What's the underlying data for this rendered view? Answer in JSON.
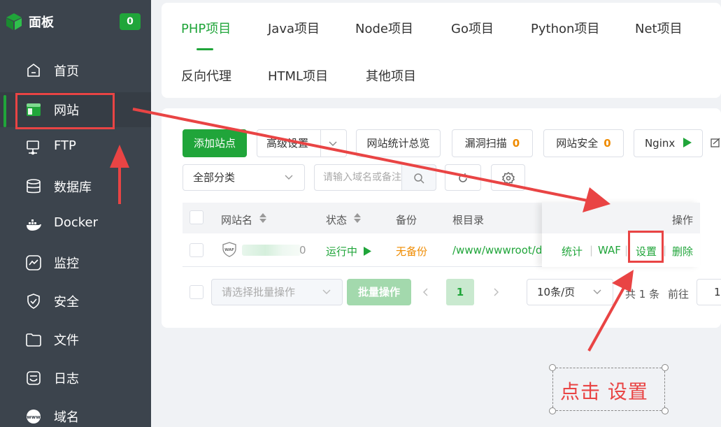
{
  "sidebar": {
    "brand": "面板",
    "badge": "0",
    "items": [
      {
        "label": "首页",
        "icon": "home-icon"
      },
      {
        "label": "网站",
        "icon": "website-icon"
      },
      {
        "label": "FTP",
        "icon": "ftp-icon"
      },
      {
        "label": "数据库",
        "icon": "database-icon"
      },
      {
        "label": "Docker",
        "icon": "docker-icon"
      },
      {
        "label": "监控",
        "icon": "monitor-icon"
      },
      {
        "label": "安全",
        "icon": "shield-icon"
      },
      {
        "label": "文件",
        "icon": "folder-icon"
      },
      {
        "label": "日志",
        "icon": "log-icon"
      },
      {
        "label": "域名",
        "icon": "globe-icon"
      }
    ]
  },
  "tabs": [
    "PHP项目",
    "Java项目",
    "Node项目",
    "Go项目",
    "Python项目",
    "Net项目",
    "反向代理",
    "HTML项目",
    "其他项目"
  ],
  "toolbar": {
    "add_site": "添加站点",
    "advanced": "高级设置",
    "stats": "网站统计总览",
    "vuln_scan": "漏洞扫描",
    "vuln_count": "0",
    "site_security": "网站安全",
    "security_count": "0",
    "nginx": "Nginx"
  },
  "filters": {
    "category": "全部分类",
    "search_placeholder": "请输入域名或备注"
  },
  "table": {
    "headers": {
      "name": "网站名",
      "status": "状态",
      "backup": "备份",
      "root": "根目录",
      "actions": "操作"
    },
    "rows": [
      {
        "name_tail": "0",
        "status": "运行中",
        "backup": "无备份",
        "root": "/www/wwwroot/d",
        "actions": [
          "统计",
          "WAF",
          "设置",
          "删除"
        ]
      }
    ]
  },
  "footer": {
    "batch_placeholder": "请选择批量操作",
    "batch_button": "批量操作",
    "current_page": "1",
    "page_size": "10条/页",
    "total": "共 1 条",
    "goto": "前往",
    "goto_value": "1"
  },
  "annotation": {
    "callout": "点击  设置",
    "color": "#e94444"
  },
  "colors": {
    "accent": "#20a53a",
    "warning": "#ef8b00",
    "sidebar_bg": "#3c444d"
  }
}
